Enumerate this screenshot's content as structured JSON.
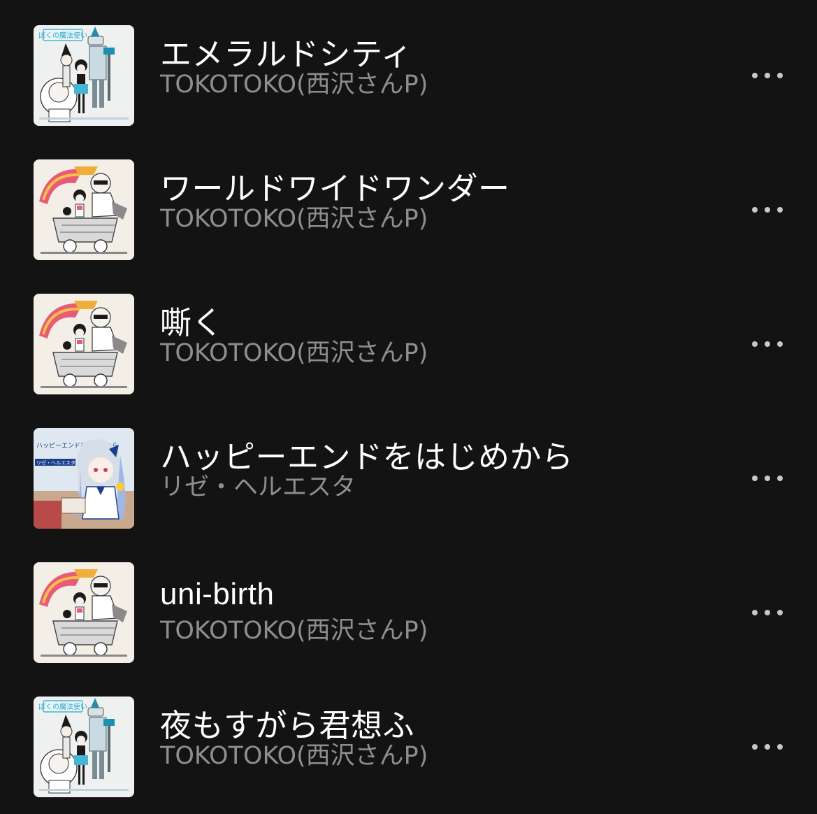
{
  "tracks": [
    {
      "title": "エメラルドシティ",
      "artist": "TOKOTOKO(西沢さんP)",
      "cover_icon": "album-cover-wizard",
      "cover_text": "ぼくの魔法使い"
    },
    {
      "title": "ワールドワイドワンダー",
      "artist": "TOKOTOKO(西沢さんP)",
      "cover_icon": "album-cover-minecart",
      "cover_text": ""
    },
    {
      "title": "嘶く",
      "artist": "TOKOTOKO(西沢さんP)",
      "cover_icon": "album-cover-minecart",
      "cover_text": ""
    },
    {
      "title": "ハッピーエンドをはじめから",
      "artist": "リゼ・ヘルエスタ",
      "cover_icon": "album-cover-lize",
      "cover_text": "ハッピーエンドをはじめから",
      "cover_subtext": "リゼ・ヘルエスタ"
    },
    {
      "title": "uni-birth",
      "artist": "TOKOTOKO(西沢さんP)",
      "cover_icon": "album-cover-minecart",
      "cover_text": ""
    },
    {
      "title": "夜もすがら君想ふ",
      "artist": "TOKOTOKO(西沢さんP)",
      "cover_icon": "album-cover-wizard",
      "cover_text": "ぼくの魔法使い"
    }
  ],
  "more_icon": "more-horizontal-icon",
  "colors": {
    "background": "#131313",
    "title": "#ffffff",
    "artist": "#8e8e8e",
    "more_dots": "#c8c8c8"
  }
}
